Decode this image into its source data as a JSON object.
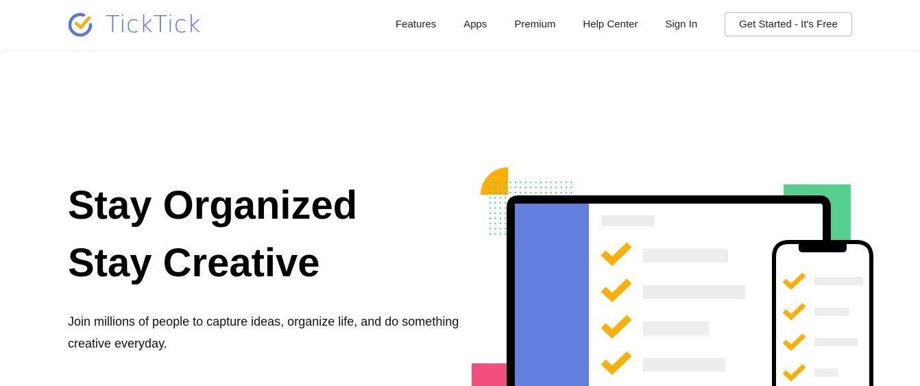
{
  "brand": {
    "name": "TickTick",
    "primary_color": "#5876E0",
    "accent_color": "#FBB003"
  },
  "nav": {
    "links": [
      "Features",
      "Apps",
      "Premium",
      "Help Center",
      "Sign In"
    ],
    "cta_label": "Get Started - It's Free"
  },
  "hero": {
    "title_line1": "Stay Organized",
    "title_line2": "Stay Creative",
    "subtitle": "Join millions of people to capture ideas, organize life, and do something creative everyday."
  },
  "illustration": {
    "colors": {
      "sidebar": "#637FDF",
      "check": "#FBB003",
      "green": "#56D08F",
      "pink": "#F24F7F",
      "placeholder": "#EDEDED",
      "dots": "#49D09B"
    },
    "laptop_tasks": 4,
    "phone_tasks": 4
  }
}
